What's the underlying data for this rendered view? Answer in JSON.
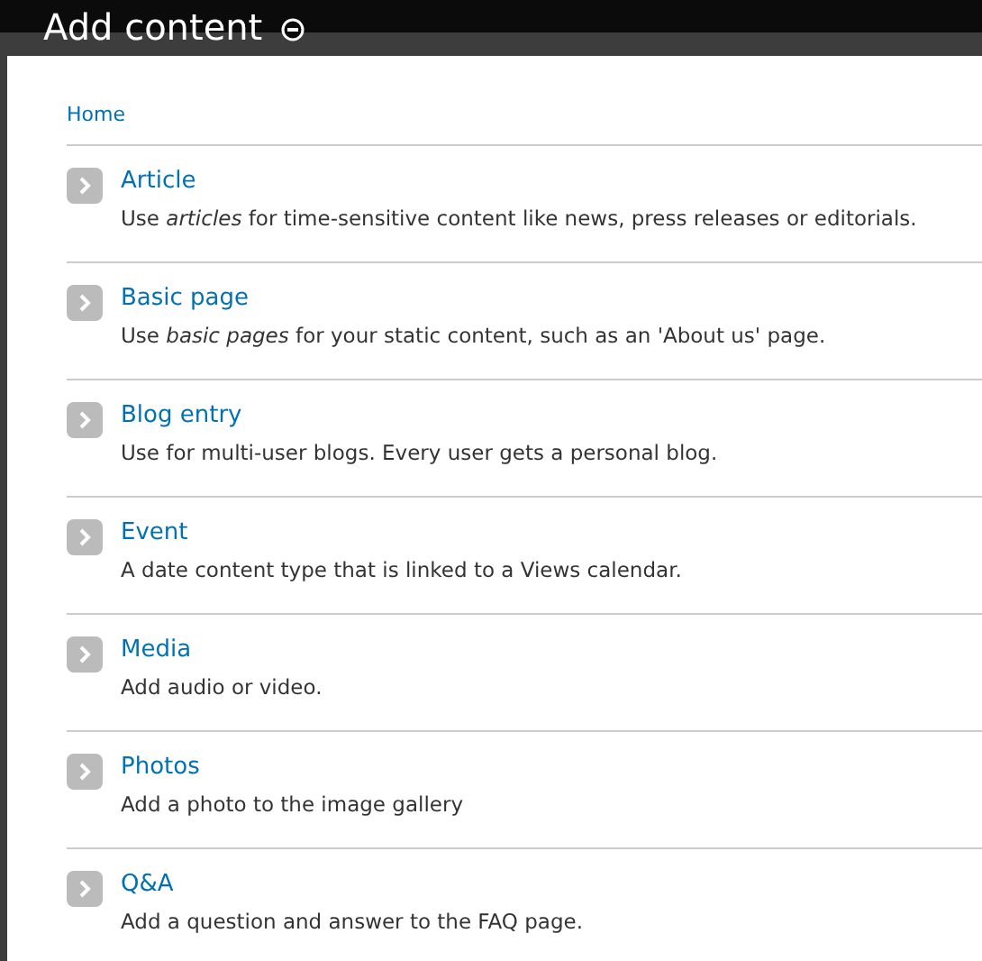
{
  "page_title": "Add content",
  "breadcrumb": "Home",
  "items": [
    {
      "title": "Article",
      "description": "Use *articles* for time-sensitive content like news, press releases or editorials."
    },
    {
      "title": "Basic page",
      "description": "Use *basic pages* for your static content, such as an 'About us' page."
    },
    {
      "title": "Blog entry",
      "description": "Use for multi-user blogs. Every user gets a personal blog."
    },
    {
      "title": "Event",
      "description": "A date content type that is linked to a Views calendar."
    },
    {
      "title": "Media",
      "description": "Add audio or video."
    },
    {
      "title": "Photos",
      "description": "Add a photo to the image gallery"
    },
    {
      "title": "Q&A",
      "description": "Add a question and answer to the FAQ page."
    }
  ]
}
